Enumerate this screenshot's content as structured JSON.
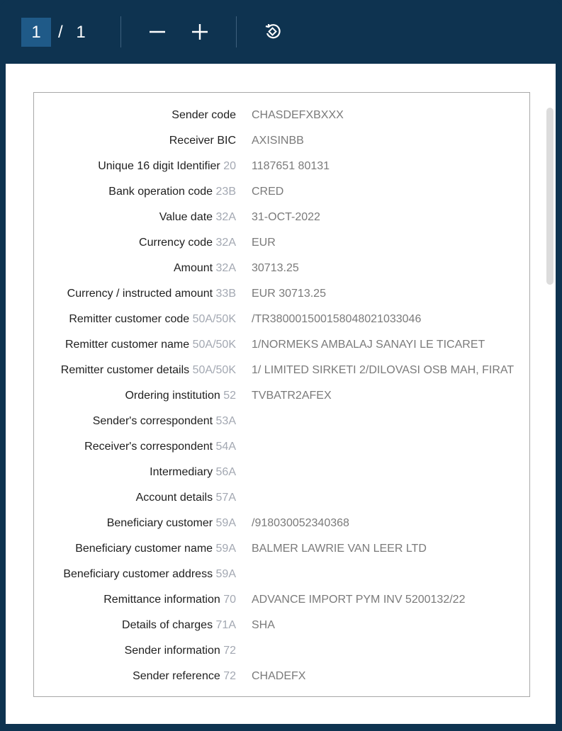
{
  "toolbar": {
    "current_page": "1",
    "page_total": "/ 1",
    "zoom_out_icon": "minus-icon",
    "zoom_in_icon": "plus-icon",
    "rotate_icon": "rotate-icon"
  },
  "colors": {
    "frame": "#0e3350",
    "page_box": "#1f5a88",
    "label_text": "#1f1f1f",
    "tag_text": "#a3a8b2",
    "value_text": "#7a7a7a"
  },
  "rows": [
    {
      "label": "Sender code",
      "tag": "",
      "value": "CHASDEFXBXXX"
    },
    {
      "label": "Receiver BIC",
      "tag": "",
      "value": "AXISINBB"
    },
    {
      "label": "Unique 16 digit Identifier",
      "tag": "20",
      "value": "1187651 80131"
    },
    {
      "label": "Bank operation code",
      "tag": "23B",
      "value": "CRED"
    },
    {
      "label": "Value date",
      "tag": "32A",
      "value": "31-OCT-2022"
    },
    {
      "label": "Currency code",
      "tag": "32A",
      "value": "EUR"
    },
    {
      "label": "Amount",
      "tag": "32A",
      "value": "30713.25"
    },
    {
      "label": "Currency / instructed amount",
      "tag": "33B",
      "value": "EUR 30713.25"
    },
    {
      "label": "Remitter customer code",
      "tag": "50A/50K",
      "value": "/TR380001500158048021033046"
    },
    {
      "label": "Remitter customer name",
      "tag": "50A/50K",
      "value": "1/NORMEKS AMBALAJ SANAYI LE TICARET"
    },
    {
      "label": "Remitter customer details",
      "tag": "50A/50K",
      "value": "1/ LIMITED SIRKETI  2/DILOVASI OSB MAH, FIRAT"
    },
    {
      "label": "Ordering institution",
      "tag": "52",
      "value": "TVBATR2AFEX"
    },
    {
      "label": "Sender's correspondent",
      "tag": "53A",
      "value": ""
    },
    {
      "label": "Receiver's correspondent",
      "tag": "54A",
      "value": ""
    },
    {
      "label": "Intermediary",
      "tag": "56A",
      "value": ""
    },
    {
      "label": "Account details",
      "tag": "57A",
      "value": ""
    },
    {
      "label": "Beneficiary customer",
      "tag": "59A",
      "value": "/918030052340368"
    },
    {
      "label": "Beneficiary customer name",
      "tag": "59A",
      "value": "BALMER LAWRIE VAN LEER LTD"
    },
    {
      "label": "Beneficiary customer address",
      "tag": "59A",
      "value": ""
    },
    {
      "label": "Remittance information",
      "tag": "70",
      "value": "ADVANCE IMPORT PYM INV 5200132/22"
    },
    {
      "label": "Details of charges",
      "tag": "71A",
      "value": "SHA"
    },
    {
      "label": "Sender information",
      "tag": "72",
      "value": ""
    },
    {
      "label": "Sender reference",
      "tag": "72",
      "value": "CHADEFX"
    }
  ]
}
